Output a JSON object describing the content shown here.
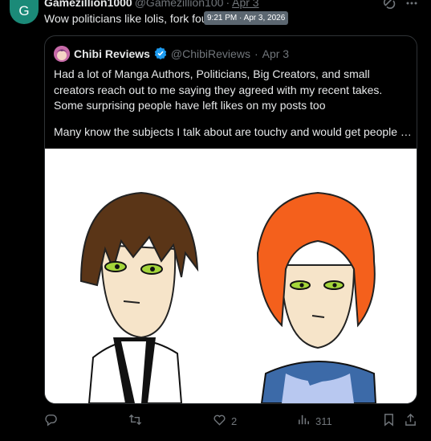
{
  "author": {
    "avatar_letter": "G",
    "name": "Gamezillion1000",
    "handle": "@Gamezillion100",
    "separator": "·",
    "date": "Apr 3"
  },
  "tweet": {
    "text": "Wow politicians like lolis, fork fou"
  },
  "tooltip": "9:21 PM · Apr 3, 2026",
  "quote": {
    "name": "Chibi Reviews",
    "handle": "@ChibiReviews",
    "separator": "·",
    "date": "Apr 3",
    "lines": [
      "Had a lot of Manga Authors, Politicians, Big Creators, and small",
      "creators reach out to me saying they agreed with my recent takes.",
      "Some surprising people have left likes on my posts too"
    ],
    "last_line": "Many know the subjects I talk about are touchy and would get people …"
  },
  "actions": {
    "reply_count": "",
    "retweet_count": "",
    "like_count": "2",
    "view_count": "311"
  },
  "colors": {
    "background": "#000000",
    "text": "#e7e9ea",
    "muted": "#71767b",
    "verified": "#1d9bf0",
    "avatar": "#1b8a78",
    "tooltip_bg": "#5b6670"
  }
}
